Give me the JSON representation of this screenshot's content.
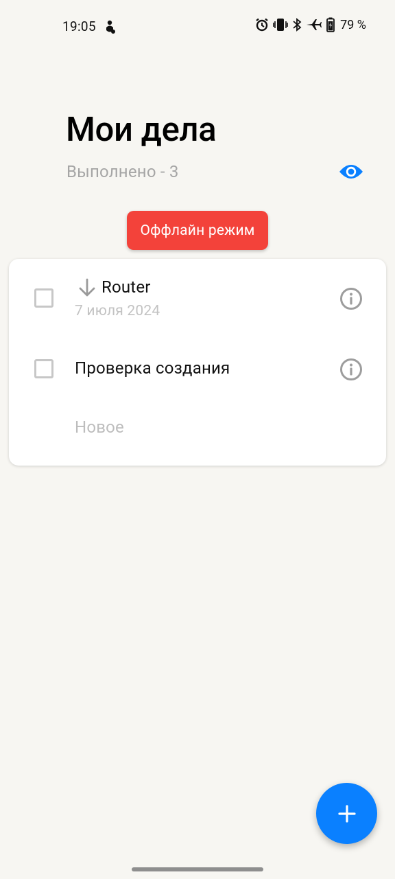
{
  "status_bar": {
    "time": "19:05",
    "left_icon": "notification-icon",
    "right_icons": [
      "alarm-icon",
      "vibrate-icon",
      "bluetooth-icon",
      "airplane-icon",
      "battery-charging-icon"
    ],
    "battery_text": "79 %"
  },
  "header": {
    "title": "Мои дела",
    "done_label": "Выполнено - 3",
    "visibility_icon": "eye-icon"
  },
  "offline_chip": {
    "label": "Оффлайн режим",
    "color": "#f3423a"
  },
  "tasks": [
    {
      "title": "Router",
      "date": "7 июля 2024",
      "priority_icon": "arrow-down-icon",
      "checked": false,
      "info_icon": "info-icon"
    },
    {
      "title": "Проверка создания",
      "checked": false,
      "info_icon": "info-icon"
    }
  ],
  "new_item_placeholder": "Новое",
  "fab": {
    "icon": "plus-icon",
    "color": "#0a80ff"
  },
  "colors": {
    "accent": "#0a80ff",
    "background": "#f7f6f2",
    "secondary_text": "#a5a5a5"
  }
}
